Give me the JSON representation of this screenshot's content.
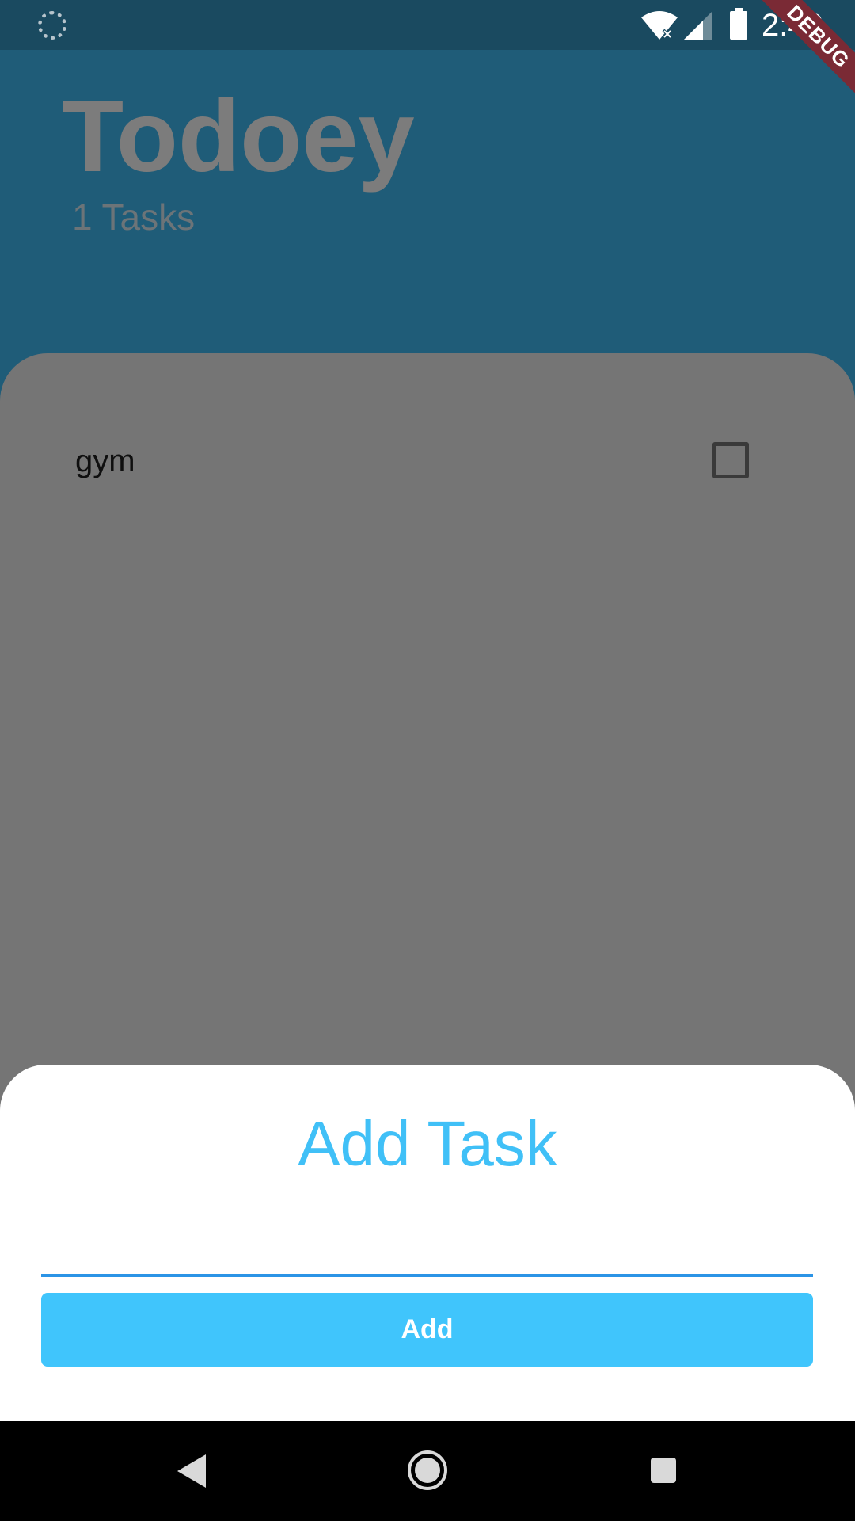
{
  "status_bar": {
    "time": "2:40",
    "icons": [
      "loading-icon",
      "wifi-off-icon",
      "cell-signal-icon",
      "battery-icon"
    ]
  },
  "debug_banner": "DEBUG",
  "header": {
    "title": "Todoey",
    "task_count": "1 Tasks"
  },
  "tasks": [
    {
      "label": "gym",
      "checked": false
    }
  ],
  "add_task_sheet": {
    "title": "Add Task",
    "input_value": "",
    "button_label": "Add"
  },
  "nav_bar": {
    "icons": [
      "back-icon",
      "home-icon",
      "recents-icon"
    ]
  },
  "colors": {
    "accent": "#40c5fc",
    "header_bg": "#1f5c78",
    "overlay_panel": "#757575",
    "input_underline": "#2b94e6"
  }
}
